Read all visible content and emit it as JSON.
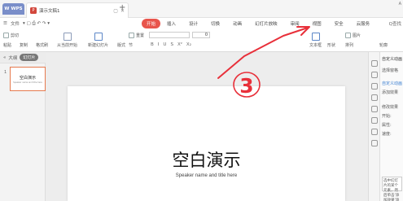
{
  "titlebar": {
    "wps_label": "WPS",
    "doc_tab_label": "演示文稿1",
    "corner_text": "A"
  },
  "menubar": {
    "file_label": "文件",
    "tabs": [
      "开始",
      "插入",
      "设计",
      "切换",
      "动画",
      "幻灯片放映",
      "审阅",
      "视图",
      "安全",
      "云服务"
    ],
    "search_label": "Q查找"
  },
  "ribbon": {
    "cut": "剪切",
    "paste": "粘贴",
    "copy": "复制",
    "format_painter": "格式刷",
    "from_current": "从当前开始",
    "new_slide": "新建幻灯片",
    "layout": "版式",
    "section": "节",
    "reset": "重置",
    "font_size": "0",
    "textbox": "文本框",
    "shape": "形状",
    "picture": "图片",
    "arrange": "排列",
    "outline": "轮廓"
  },
  "leftpane": {
    "outline_tab": "大纲",
    "slides_tab": "幻灯片",
    "slide_number": "1",
    "thumb_title": "空白演示",
    "thumb_sub": "Speaker name and title here"
  },
  "slide": {
    "title": "空白演示",
    "subtitle": "Speaker name and title here"
  },
  "rightpanel": {
    "header": "自定义动画",
    "select_pane": "选择窗格",
    "custom_anim": "自定义动画",
    "add_effect": "添加效果",
    "modify": "修改效果",
    "start": "开始:",
    "property": "属性:",
    "speed": "速度:",
    "note": "选中幻灯片的某个元素，然后单击'添加效果'添加动画。"
  },
  "annotation": {
    "label": "3",
    "color": "#e8303a"
  }
}
